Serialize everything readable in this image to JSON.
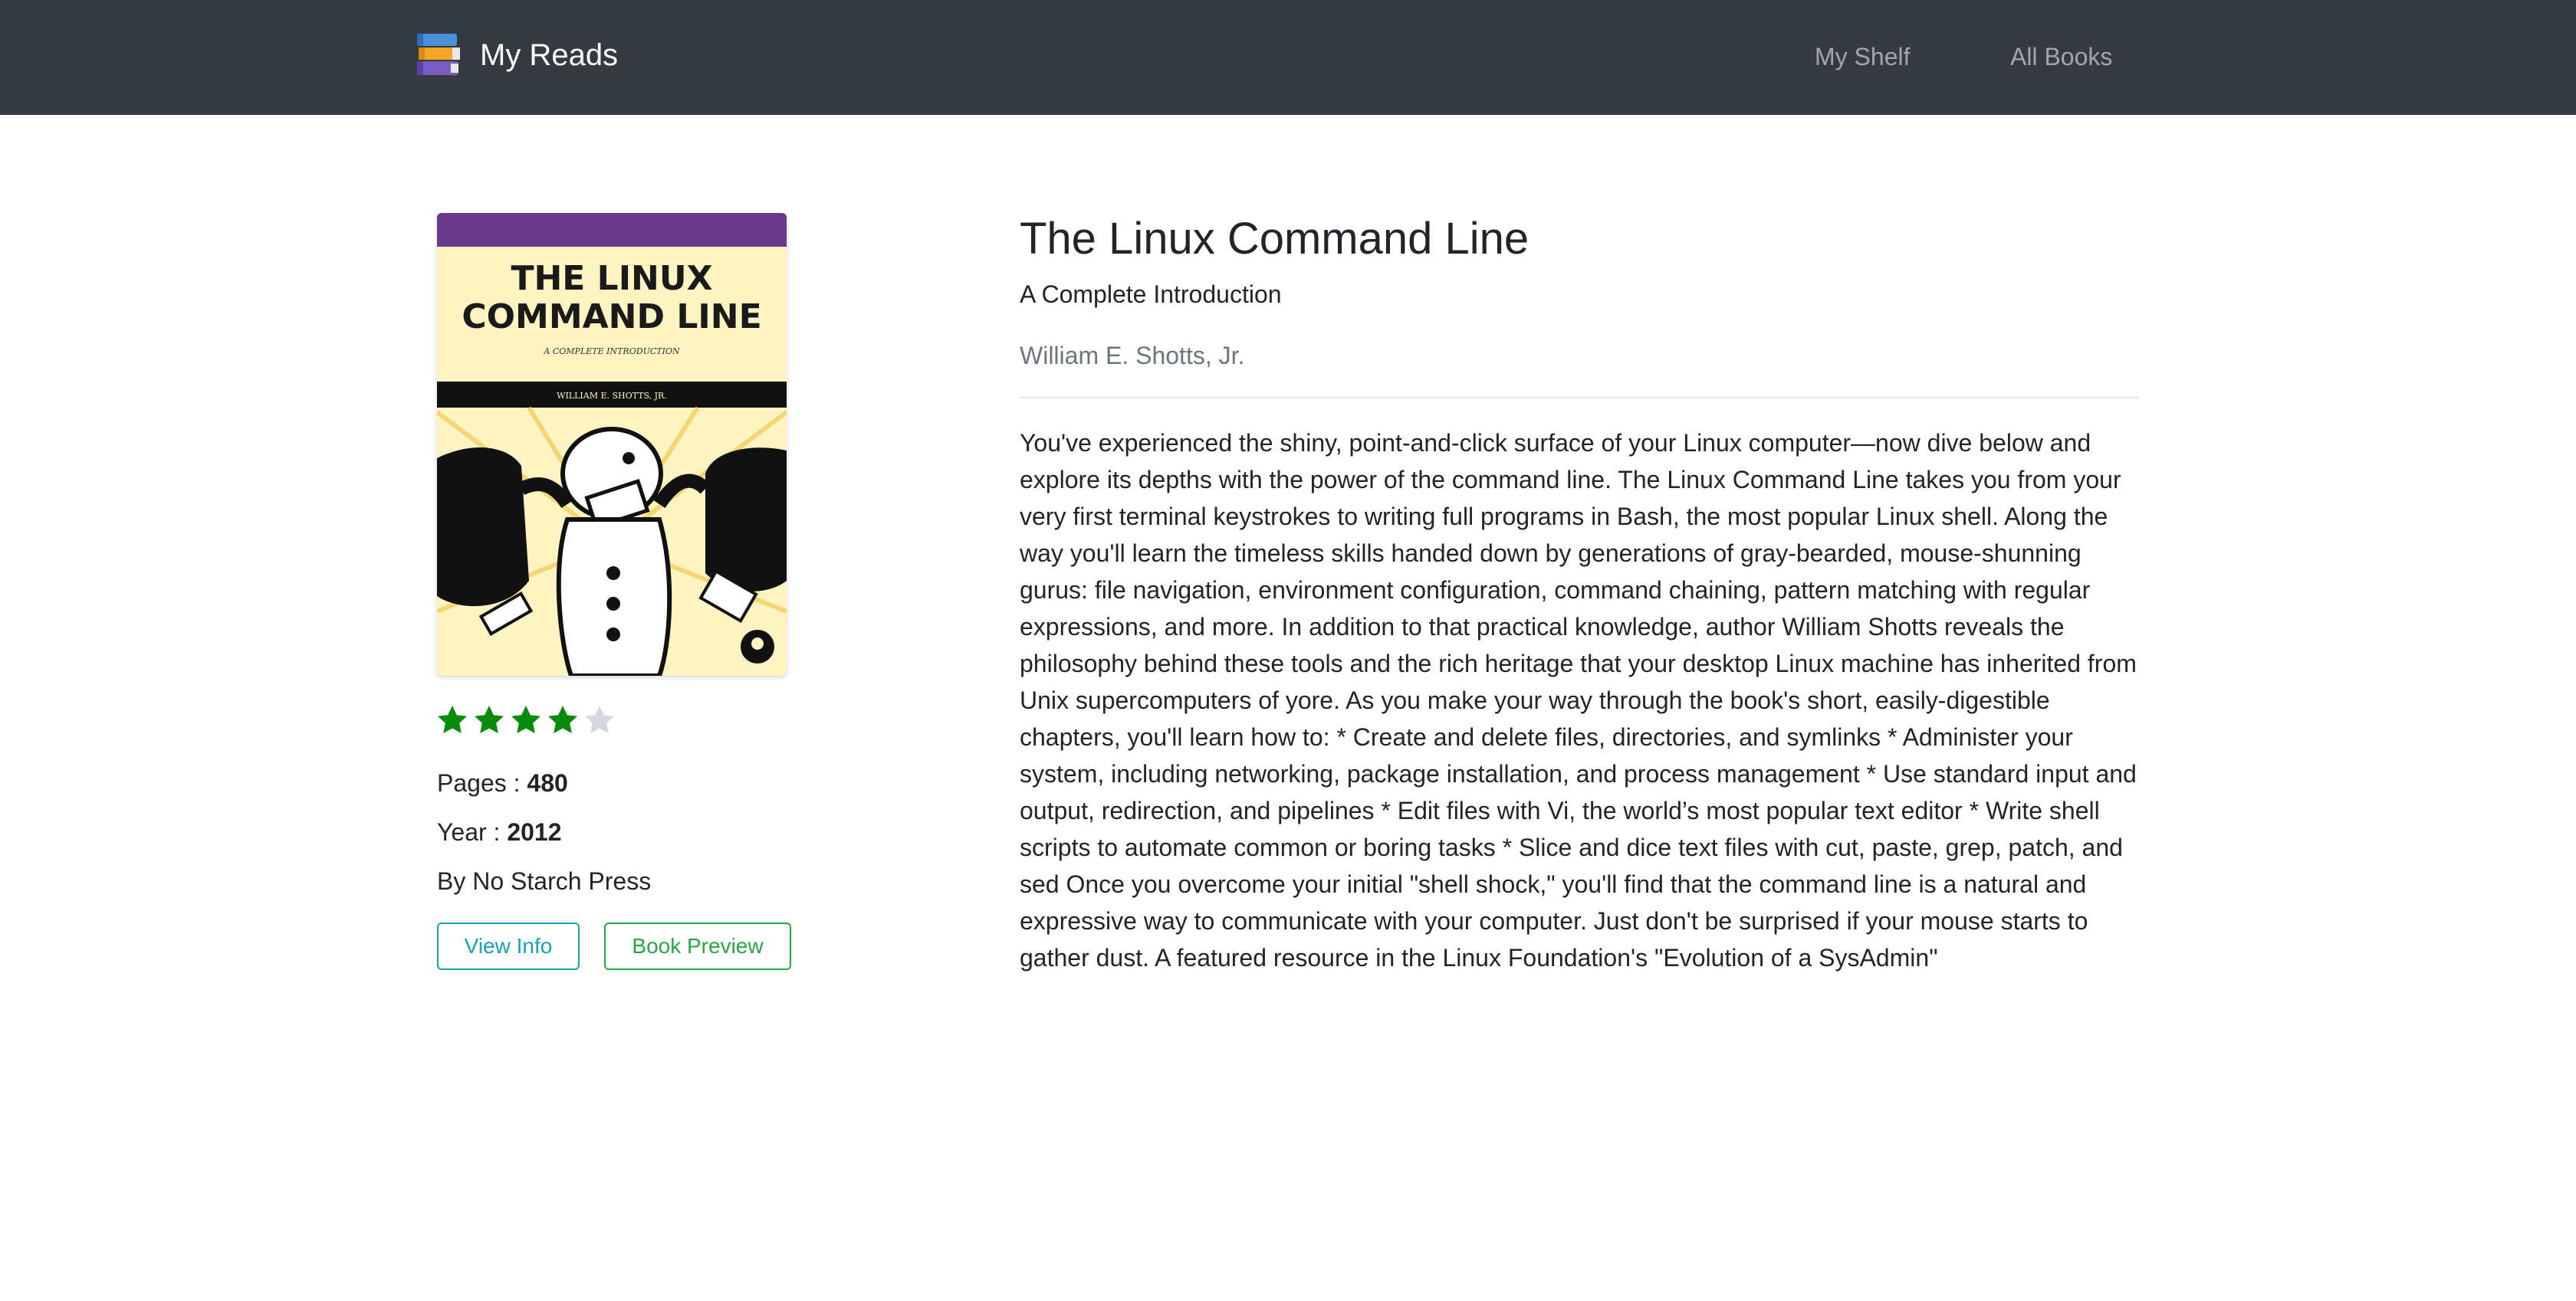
{
  "navbar": {
    "brand": "My Reads",
    "brand_icon": "books-stack-icon",
    "links": [
      "My Shelf",
      "All Books"
    ]
  },
  "book": {
    "cover_icon": "book-cover-image",
    "rating": 4,
    "rating_max": 5,
    "pages_label": "Pages : ",
    "pages": "480",
    "year_label": "Year : ",
    "year": "2012",
    "publisher": "By No Starch Press",
    "title": "The Linux Command Line",
    "subtitle": "A Complete Introduction",
    "author": "William E. Shotts, Jr.",
    "description": "You've experienced the shiny, point-and-click surface of your Linux computer—now dive below and explore its depths with the power of the command line. The Linux Command Line takes you from your very first terminal keystrokes to writing full programs in Bash, the most popular Linux shell. Along the way you'll learn the timeless skills handed down by generations of gray-bearded, mouse-shunning gurus: file navigation, environment configuration, command chaining, pattern matching with regular expressions, and more. In addition to that practical knowledge, author William Shotts reveals the philosophy behind these tools and the rich heritage that your desktop Linux machine has inherited from Unix supercomputers of yore. As you make your way through the book's short, easily-digestible chapters, you'll learn how to: * Create and delete files, directories, and symlinks * Administer your system, including networking, package installation, and process management * Use standard input and output, redirection, and pipelines * Edit files with Vi, the world’s most popular text editor * Write shell scripts to automate common or boring tasks * Slice and dice text files with cut, paste, grep, patch, and sed Once you overcome your initial \"shell shock,\" you'll find that the command line is a natural and expressive way to communicate with your computer. Just don't be surprised if your mouse starts to gather dust. A featured resource in the Linux Foundation's \"Evolution of a SysAdmin\""
  },
  "cover_text": {
    "line1": "THE LINUX",
    "line2": "COMMAND LINE",
    "tagline": "A COMPLETE INTRODUCTION",
    "byline": "WILLIAM E. SHOTTS, JR."
  },
  "actions": {
    "view_info": "View Info",
    "book_preview": "Book Preview"
  },
  "colors": {
    "navbar_bg": "#343a40",
    "star_filled": "#0a8a0a",
    "star_empty": "#d3d9df",
    "info_outline": "#17a2b8",
    "success_outline": "#28a745"
  }
}
